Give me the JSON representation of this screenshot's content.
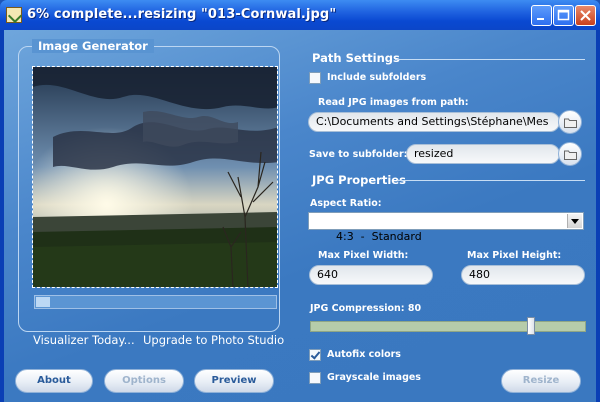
{
  "window": {
    "title": "6% complete...resizing \"013-Cornwal.jpg\""
  },
  "titlebar_buttons": [
    "minimize",
    "maximize",
    "close"
  ],
  "image_generator": {
    "title": "Image Generator",
    "progress": 0.06
  },
  "links": {
    "visualizer": "Visualizer Today...",
    "upgrade": "Upgrade to Photo Studio"
  },
  "buttons": {
    "about": "About",
    "options": "Options",
    "preview": "Preview",
    "resize": "Resize"
  },
  "path_settings": {
    "title": "Path Settings",
    "include_subfolders": {
      "label": "Include subfolders",
      "checked": false
    },
    "read_path_label": "Read JPG images from path:",
    "read_path_value": "C:\\Documents and Settings\\Stéphane\\Mes",
    "save_subfolder_label": "Save to subfolder:",
    "save_subfolder_value": "resized"
  },
  "jpg_properties": {
    "title": "JPG Properties",
    "aspect_ratio_label": "Aspect Ratio:",
    "aspect_ratio_value": "4:3  -  Standard",
    "max_width_label": "Max Pixel Width:",
    "max_width_value": "640",
    "max_height_label": "Max Pixel Height:",
    "max_height_value": "480",
    "compression_label": "JPG Compression: 80",
    "compression_value": 80,
    "autofix": {
      "label": "Autofix colors",
      "checked": true
    },
    "grayscale": {
      "label": "Grayscale images",
      "checked": false
    }
  },
  "colors": {
    "accent": "#3b79c1",
    "titlebar": "#1f62e0"
  }
}
